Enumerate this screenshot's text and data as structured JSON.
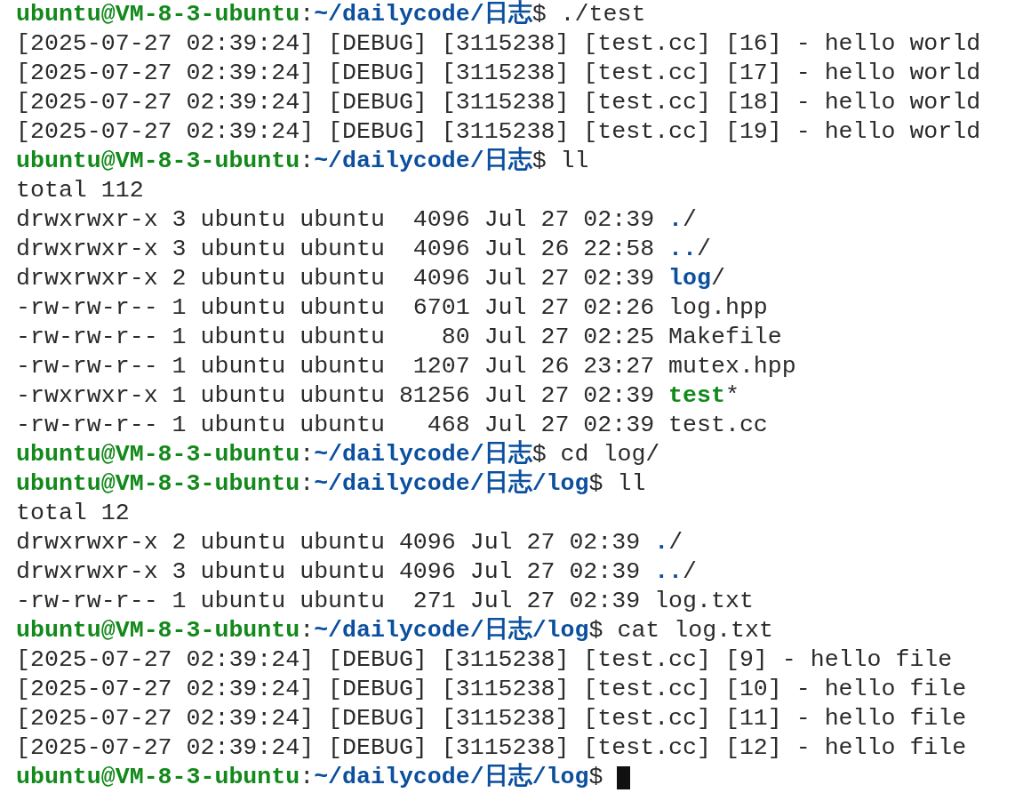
{
  "terminal": {
    "lines": [
      {
        "kind": "prompt",
        "user_host": "ubuntu@VM-8-3-ubuntu",
        "separator": ":",
        "path": "~/dailycode/日志",
        "sign": "$",
        "command": "./test",
        "cursor": false
      },
      {
        "kind": "text",
        "text": "[2025-07-27 02:39:24] [DEBUG] [3115238] [test.cc] [16] - hello world"
      },
      {
        "kind": "text",
        "text": "[2025-07-27 02:39:24] [DEBUG] [3115238] [test.cc] [17] - hello world"
      },
      {
        "kind": "text",
        "text": "[2025-07-27 02:39:24] [DEBUG] [3115238] [test.cc] [18] - hello world"
      },
      {
        "kind": "text",
        "text": "[2025-07-27 02:39:24] [DEBUG] [3115238] [test.cc] [19] - hello world"
      },
      {
        "kind": "prompt",
        "user_host": "ubuntu@VM-8-3-ubuntu",
        "separator": ":",
        "path": "~/dailycode/日志",
        "sign": "$",
        "command": "ll",
        "cursor": false
      },
      {
        "kind": "text",
        "text": "total 112"
      },
      {
        "kind": "entry",
        "info": "drwxrwxr-x 3 ubuntu ubuntu  4096 Jul 27 02:39",
        "name": ".",
        "suffix": "/",
        "color": "#0b4f9e"
      },
      {
        "kind": "entry",
        "info": "drwxrwxr-x 3 ubuntu ubuntu  4096 Jul 26 22:58",
        "name": "..",
        "suffix": "/",
        "color": "#0b4f9e"
      },
      {
        "kind": "entry",
        "info": "drwxrwxr-x 2 ubuntu ubuntu  4096 Jul 27 02:39",
        "name": "log",
        "suffix": "/",
        "color": "#0b4f9e"
      },
      {
        "kind": "entry",
        "info": "-rw-rw-r-- 1 ubuntu ubuntu  6701 Jul 27 02:26",
        "name": "log.hpp"
      },
      {
        "kind": "entry",
        "info": "-rw-rw-r-- 1 ubuntu ubuntu    80 Jul 27 02:25",
        "name": "Makefile"
      },
      {
        "kind": "entry",
        "info": "-rw-rw-r-- 1 ubuntu ubuntu  1207 Jul 26 23:27",
        "name": "mutex.hpp"
      },
      {
        "kind": "entry",
        "info": "-rwxrwxr-x 1 ubuntu ubuntu 81256 Jul 27 02:39",
        "name": "test",
        "suffix": "*",
        "color": "#12891a"
      },
      {
        "kind": "entry",
        "info": "-rw-rw-r-- 1 ubuntu ubuntu   468 Jul 27 02:39",
        "name": "test.cc"
      },
      {
        "kind": "prompt",
        "user_host": "ubuntu@VM-8-3-ubuntu",
        "separator": ":",
        "path": "~/dailycode/日志",
        "sign": "$",
        "command": "cd log/",
        "cursor": false
      },
      {
        "kind": "prompt",
        "user_host": "ubuntu@VM-8-3-ubuntu",
        "separator": ":",
        "path": "~/dailycode/日志/log",
        "sign": "$",
        "command": "ll",
        "cursor": false
      },
      {
        "kind": "text",
        "text": "total 12"
      },
      {
        "kind": "entry",
        "info": "drwxrwxr-x 2 ubuntu ubuntu 4096 Jul 27 02:39",
        "name": ".",
        "suffix": "/",
        "color": "#0b4f9e"
      },
      {
        "kind": "entry",
        "info": "drwxrwxr-x 3 ubuntu ubuntu 4096 Jul 27 02:39",
        "name": "..",
        "suffix": "/",
        "color": "#0b4f9e"
      },
      {
        "kind": "entry",
        "info": "-rw-rw-r-- 1 ubuntu ubuntu  271 Jul 27 02:39",
        "name": "log.txt"
      },
      {
        "kind": "prompt",
        "user_host": "ubuntu@VM-8-3-ubuntu",
        "separator": ":",
        "path": "~/dailycode/日志/log",
        "sign": "$",
        "command": "cat log.txt",
        "cursor": false
      },
      {
        "kind": "text",
        "text": "[2025-07-27 02:39:24] [DEBUG] [3115238] [test.cc] [9] - hello file"
      },
      {
        "kind": "text",
        "text": "[2025-07-27 02:39:24] [DEBUG] [3115238] [test.cc] [10] - hello file"
      },
      {
        "kind": "text",
        "text": "[2025-07-27 02:39:24] [DEBUG] [3115238] [test.cc] [11] - hello file"
      },
      {
        "kind": "text",
        "text": "[2025-07-27 02:39:24] [DEBUG] [3115238] [test.cc] [12] - hello file"
      },
      {
        "kind": "prompt",
        "user_host": "ubuntu@VM-8-3-ubuntu",
        "separator": ":",
        "path": "~/dailycode/日志/log",
        "sign": "$",
        "cursor": true
      }
    ]
  }
}
